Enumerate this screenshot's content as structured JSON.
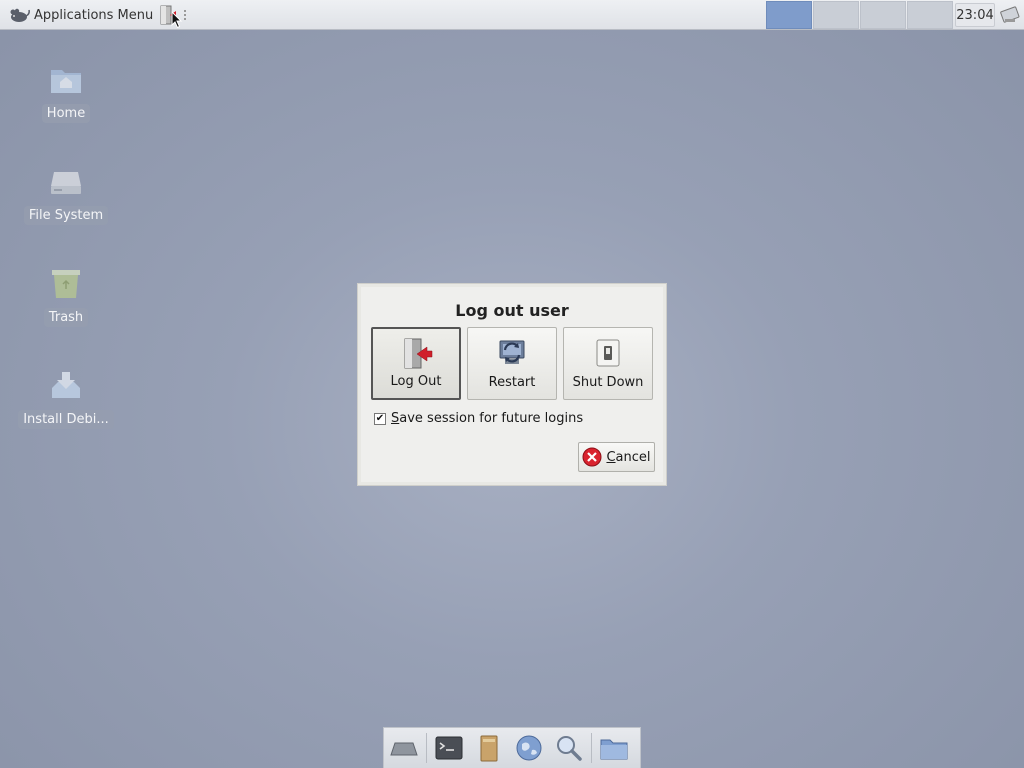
{
  "panel": {
    "apps_menu_label": "Applications Menu",
    "clock": "23:04",
    "workspaces": [
      {
        "active": true
      },
      {
        "active": false
      },
      {
        "active": false
      },
      {
        "active": false
      }
    ]
  },
  "desktop": {
    "icons": [
      {
        "label": "Home",
        "icon": "home-folder-icon"
      },
      {
        "label": "File System",
        "icon": "drive-icon"
      },
      {
        "label": "Trash",
        "icon": "trash-icon"
      },
      {
        "label": "Install Debi...",
        "icon": "install-icon"
      }
    ]
  },
  "dialog": {
    "title": "Log out user",
    "buttons": {
      "logout": "Log Out",
      "restart": "Restart",
      "shutdown": "Shut Down"
    },
    "save_session": {
      "checked": true,
      "mnemonic": "S",
      "rest": "ave session for future logins"
    },
    "cancel": {
      "mnemonic": "C",
      "rest": "ancel"
    }
  },
  "dock": {
    "items": [
      "show-desktop-icon",
      "terminal-icon",
      "file-manager-icon",
      "web-browser-icon",
      "app-finder-icon",
      "folder-icon"
    ]
  },
  "colors": {
    "workspace_active": "#7f9ccb",
    "cancel_red": "#d9232e",
    "logout_arrow": "#d01f2a"
  }
}
